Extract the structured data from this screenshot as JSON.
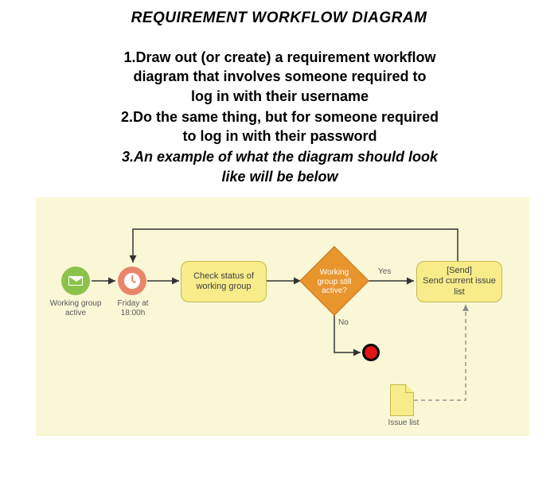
{
  "title": "REQUIREMENT WORKFLOW DIAGRAM",
  "instructions": {
    "item1": {
      "num": "1.",
      "line1": "Draw out (or create) a requirement workflow",
      "line2": "diagram that involves someone required to",
      "line3": "log in with their username"
    },
    "item2": {
      "num": "2.",
      "line1": "Do the same thing, but for someone required",
      "line2": "to log in with their password"
    },
    "item3": {
      "num": "3.",
      "line1": "An example of what the diagram should look",
      "line2": "like will be below"
    }
  },
  "diagram": {
    "start_label": "Working group active",
    "timer_label": "Friday at 18:00h",
    "task_check": "Check status of working group",
    "gateway_label": "Working group still active?",
    "edge_yes": "Yes",
    "edge_no": "No",
    "task_send": "[Send]\nSend current issue list",
    "data_obj_label": "Issue list",
    "colors": {
      "canvas": "#f9f7d6",
      "start": "#8dc24a",
      "timer": "#e9856a",
      "task": "#f7eb8a",
      "gateway": "#e8952e",
      "end": "#e01515"
    }
  }
}
